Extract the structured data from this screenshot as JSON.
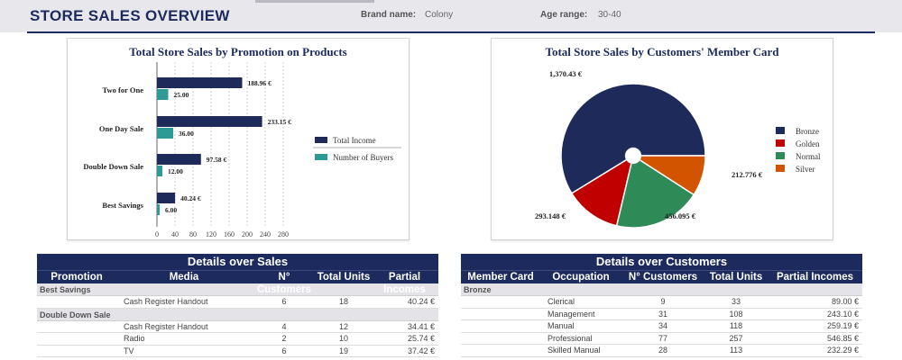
{
  "header": {
    "title": "STORE SALES OVERVIEW",
    "brand_label": "Brand name:",
    "brand_value": "Colony",
    "age_label": "Age range:",
    "age_value": "30-40"
  },
  "promo_chart": {
    "title": "Total Store Sales by Promotion on Products",
    "legend": [
      "Total Income",
      "Number of Buyers"
    ],
    "colors": {
      "income": "#1e2a5a",
      "buyers": "#2e9a96"
    }
  },
  "member_chart": {
    "title": "Total Store Sales by Customers' Member Card",
    "legend": [
      "Bronze",
      "Golden",
      "Normal",
      "Silver"
    ],
    "colors": [
      "#1e2a5a",
      "#c00000",
      "#2e8b57",
      "#d35400"
    ]
  },
  "chart_data": [
    {
      "type": "bar",
      "orientation": "horizontal",
      "title": "Total Store Sales by Promotion on Products",
      "categories": [
        "Two for One",
        "One Day Sale",
        "Double Down Sale",
        "Best Savings"
      ],
      "series": [
        {
          "name": "Total Income",
          "values": [
            188.96,
            233.15,
            97.58,
            40.24
          ],
          "labels": [
            "188.96 €",
            "233.15 €",
            "97.58 €",
            "40.24 €"
          ]
        },
        {
          "name": "Number of Buyers",
          "values": [
            25,
            36,
            12,
            6
          ],
          "labels": [
            "25.00",
            "36.00",
            "12.00",
            "6.00"
          ]
        }
      ],
      "xlim": [
        0,
        280
      ],
      "xticks": [
        "0",
        "40",
        "80",
        "120",
        "160",
        "200",
        "240",
        "280"
      ],
      "grid": true,
      "legend_position": "right"
    },
    {
      "type": "pie",
      "title": "Total Store Sales by Customers' Member Card",
      "categories": [
        "Bronze",
        "Golden",
        "Normal",
        "Silver"
      ],
      "values": [
        1370.43,
        293.148,
        456.095,
        212.776
      ],
      "labels": [
        "1,370.43 €",
        "293.148 €",
        "456.095 €",
        "212.776 €"
      ],
      "legend_position": "right"
    }
  ],
  "sales_table": {
    "title": "Details over Sales",
    "columns": [
      "Promotion",
      "Media",
      "N° Customers",
      "Total Units",
      "Partial Incomes"
    ],
    "groups": [
      {
        "name": "Best Savings",
        "rows": [
          [
            "",
            "Cash Register Handout",
            "6",
            "18",
            "40.24 €"
          ]
        ]
      },
      {
        "name": "Double Down Sale",
        "rows": [
          [
            "",
            "Cash Register Handout",
            "4",
            "12",
            "34.41 €"
          ],
          [
            "",
            "Radio",
            "2",
            "10",
            "25.74 €"
          ],
          [
            "",
            "TV",
            "6",
            "19",
            "37.42 €"
          ]
        ]
      }
    ]
  },
  "customers_table": {
    "title": "Details over Customers",
    "columns": [
      "Member Card",
      "Occupation",
      "N° Customers",
      "Total Units",
      "Partial Incomes"
    ],
    "groups": [
      {
        "name": "Bronze",
        "rows": [
          [
            "",
            "Clerical",
            "9",
            "33",
            "89.00 €"
          ],
          [
            "",
            "Management",
            "31",
            "108",
            "243.10 €"
          ],
          [
            "",
            "Manual",
            "34",
            "118",
            "259.19 €"
          ],
          [
            "",
            "Professional",
            "77",
            "257",
            "546.85 €"
          ],
          [
            "",
            "Skilled Manual",
            "28",
            "113",
            "232.29 €"
          ]
        ]
      }
    ]
  }
}
